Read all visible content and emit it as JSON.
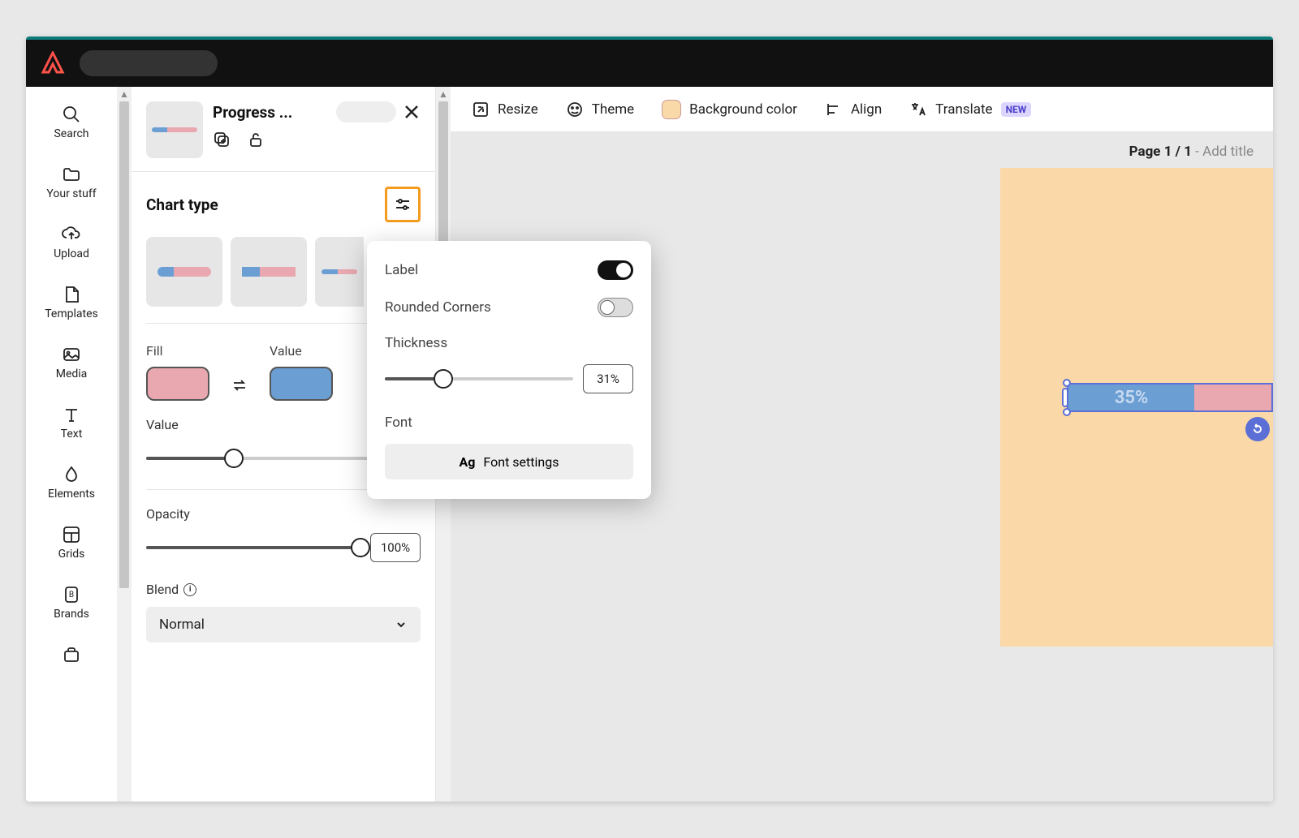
{
  "nav": {
    "search": "Search",
    "yourstuff": "Your stuff",
    "upload": "Upload",
    "templates": "Templates",
    "media": "Media",
    "text": "Text",
    "elements": "Elements",
    "grids": "Grids",
    "brands": "Brands"
  },
  "props": {
    "title": "Progress ...",
    "chart_type": "Chart type",
    "fill_label": "Fill",
    "value_label": "Value",
    "value_slider_label": "Value",
    "opacity_label": "Opacity",
    "opacity_value": "100%",
    "blend_label": "Blend",
    "blend_value": "Normal"
  },
  "popover": {
    "label": "Label",
    "rounded": "Rounded Corners",
    "thickness": "Thickness",
    "thickness_value": "31%",
    "font": "Font",
    "font_button_prefix": "Ag",
    "font_button": "Font settings"
  },
  "toolbar": {
    "resize": "Resize",
    "theme": "Theme",
    "bgcolor": "Background color",
    "align": "Align",
    "translate": "Translate",
    "new": "NEW"
  },
  "canvas": {
    "page_prefix": "Page 1 / 1",
    "page_suffix": " - Add title",
    "progress_label": "35%"
  },
  "chart_data": {
    "type": "bar",
    "title": "Progress bar",
    "values": [
      35
    ],
    "max": 100,
    "fill_color": "#6b9fd4",
    "rest_color": "#e9a8b0",
    "label": "35%"
  }
}
